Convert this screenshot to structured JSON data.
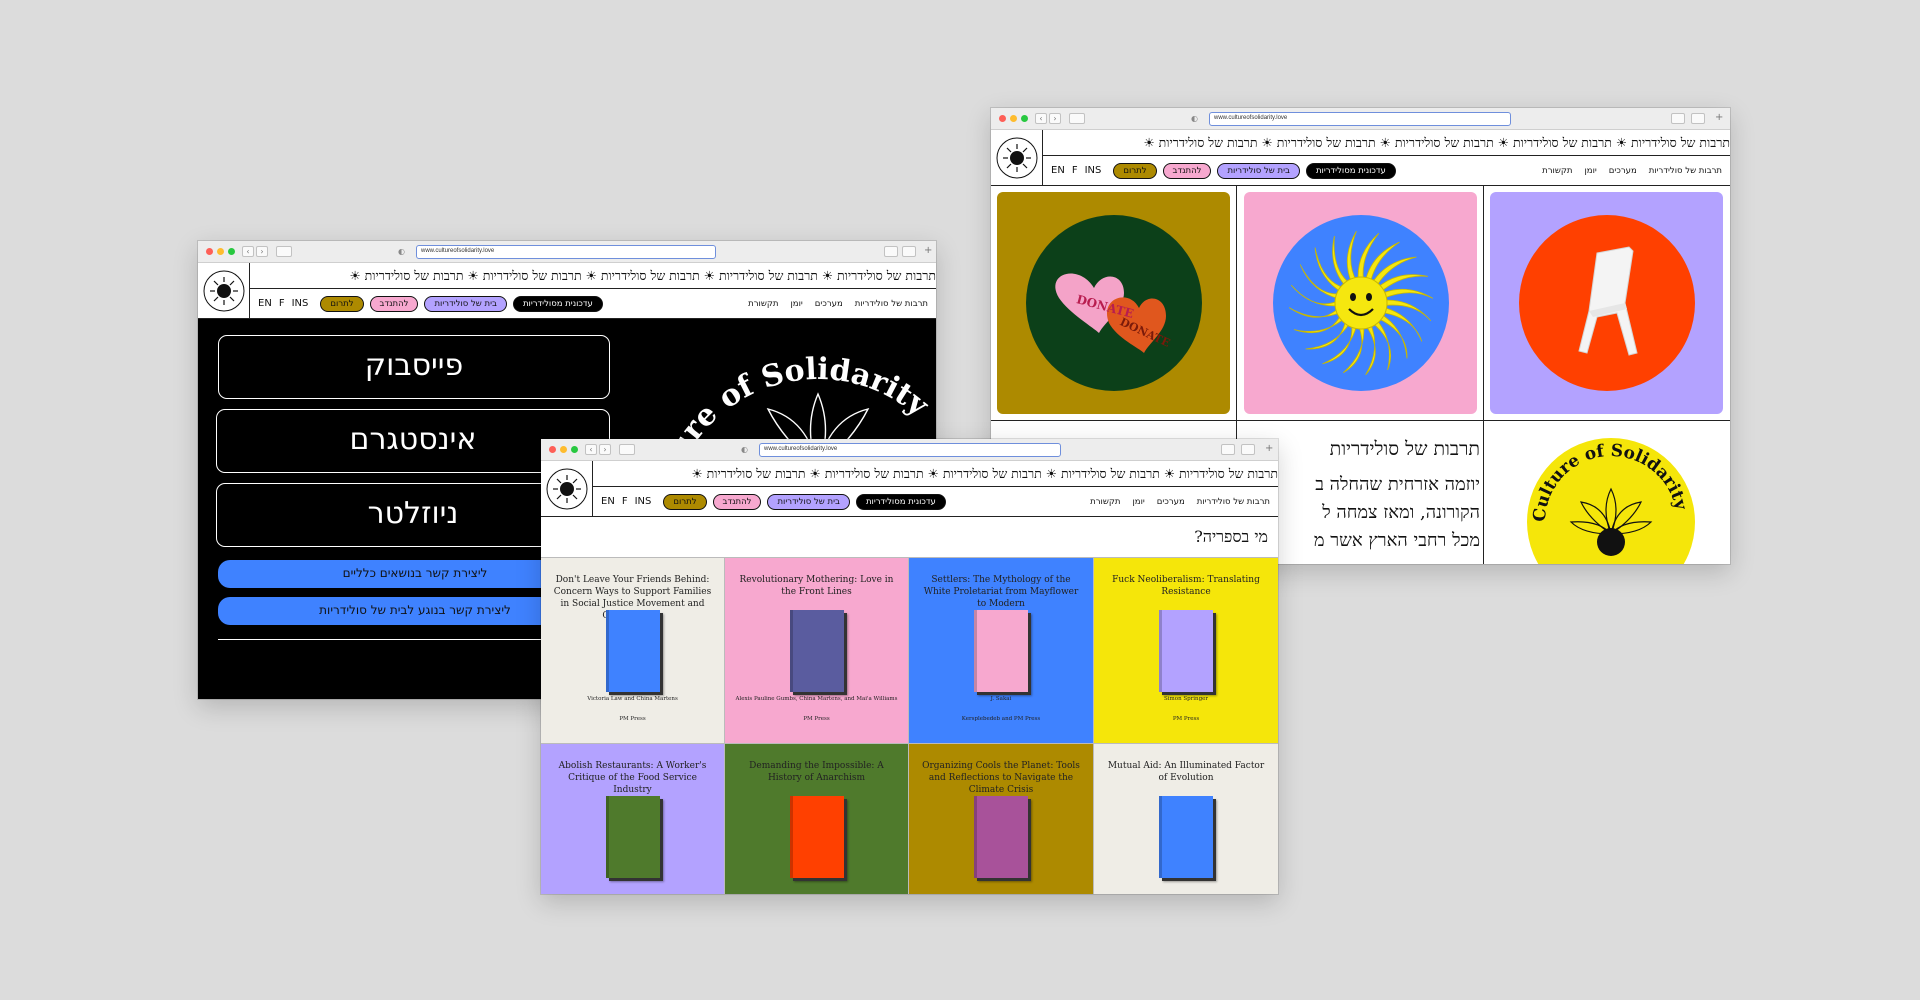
{
  "url": "www.cultureofsolidarity.love",
  "ticker_unit": "תרבות של סולידריות ☀",
  "logo_text": "Culture of Solidarity · תרבות של סולידריות",
  "lang": [
    "EN",
    "F",
    "INS"
  ],
  "pills": [
    {
      "label": "עדכונית מסולידריות",
      "bg": "#000000",
      "fg": "#ffffff"
    },
    {
      "label": "בית של סולידריות",
      "bg": "#b3a2ff",
      "fg": "#111111"
    },
    {
      "label": "להתנדב",
      "bg": "#f7a8cf",
      "fg": "#111111"
    },
    {
      "label": "לתרום",
      "bg": "#ad8a00",
      "fg": "#111111"
    }
  ],
  "links": [
    "תרבות של סולידריות",
    "מערכים",
    "יומן",
    "תקשורת"
  ],
  "contact": {
    "social": [
      "פייסבוק",
      "אינסטגרם",
      "ניוזלטר"
    ],
    "buttons": [
      "ליצירת קשר בנושאים כלליים",
      "ליצירת קשר בנוגע לבית של סולידריות"
    ],
    "circle_text": "Culture of Solidarity"
  },
  "home": {
    "tiles": [
      {
        "bg": "#ad8a00",
        "circle": "#0c4019",
        "icon": "hearts-donate-icon",
        "text": "DONATE"
      },
      {
        "bg": "#f7a8cf",
        "circle": "#3f82ff",
        "icon": "smiling-sun-icon"
      },
      {
        "bg": "#b3a2ff",
        "circle": "#ff4000",
        "icon": "chair-icon"
      }
    ],
    "heading": "תרבות של סולידריות",
    "paragraph": [
      "יוזמה אזרחית שהחלה ב",
      "הקורונה, ומאז צמחה ל",
      "מכל רחבי הארץ אשר מ"
    ],
    "seal_text": "Culture of Solidarity",
    "seal_bg": "#f5e60a"
  },
  "library": {
    "question": "מי בספריה?",
    "books": [
      {
        "title": "Don't Leave Your Friends Behind: Concern Ways to Support Families in Social Justice Movement and Communities",
        "author": "Victoria Law and China Martens",
        "publisher": "PM Press",
        "bg": "#efede6",
        "cover": "#3f82ff"
      },
      {
        "title": "Revolutionary Mothering: Love in the Front Lines",
        "author": "Alexis Pauline Gumbs, China Martens, and Mai'a Williams",
        "publisher": "PM Press",
        "bg": "#f7a8cf",
        "cover": "#5a5c9f"
      },
      {
        "title": "Settlers: The Mythology of the White Proletariat from Mayflower to Modern",
        "author": "J. Sakai",
        "publisher": "Kersplebedeb and PM Press",
        "bg": "#3f82ff",
        "cover": "#f7a8cf"
      },
      {
        "title": "Fuck Neoliberalism: Translating Resistance",
        "author": "Simon Springer",
        "publisher": "PM Press",
        "bg": "#f5e60a",
        "cover": "#b3a2ff"
      },
      {
        "title": "Abolish Restaurants: A Worker's Critique of the Food Service Industry",
        "author": "",
        "publisher": "",
        "bg": "#b3a2ff",
        "cover": "#4f7a2c"
      },
      {
        "title": "Demanding the Impossible: A History of Anarchism",
        "author": "",
        "publisher": "",
        "bg": "#4f7a2c",
        "cover": "#ff4000"
      },
      {
        "title": "Organizing Cools the Planet: Tools and Reflections to Navigate the Climate Crisis",
        "author": "",
        "publisher": "",
        "bg": "#ad8a00",
        "cover": "#a8529a"
      },
      {
        "title": "Mutual Aid: An Illuminated Factor of Evolution",
        "author": "",
        "publisher": "",
        "bg": "#efede6",
        "cover": "#3f82ff"
      }
    ]
  }
}
